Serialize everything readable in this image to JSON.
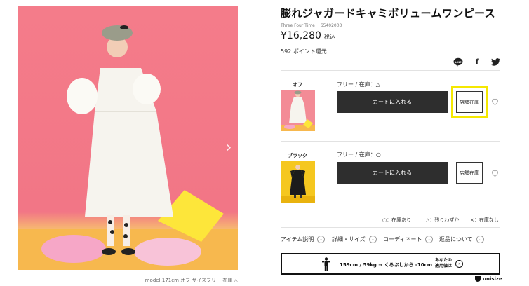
{
  "product": {
    "title": "膨れジャガードキャミボリュームワンピース",
    "brand": "Three Four Time",
    "code": "65402003",
    "price": "¥16,280",
    "tax_label": "税込",
    "points": "592 ポイント還元"
  },
  "photo": {
    "next_arrow": "›",
    "caption": "model:171cm オフ サイズフリー 在庫 △"
  },
  "share": {
    "line_icon": "line-icon",
    "line_label": "LINE",
    "facebook_icon": "facebook-icon",
    "facebook_label": "f",
    "twitter_icon": "twitter-icon"
  },
  "variants": [
    {
      "color": "オフ",
      "stock": "フリー / 在庫：△",
      "cart_label": "カートに入れる",
      "store_label": "店舗在庫",
      "favorite_icon": "heart-icon"
    },
    {
      "color": "ブラック",
      "stock": "フリー / 在庫：○",
      "cart_label": "カートに入れる",
      "store_label": "店舗在庫",
      "favorite_icon": "heart-icon"
    }
  ],
  "legend": {
    "in_stock": "○：在庫あり",
    "few_left": "△：残りわずか",
    "none": "×：在庫なし"
  },
  "tabs": [
    {
      "label": "アイテム説明",
      "icon": "chevron-down-icon",
      "glyph": "⌄"
    },
    {
      "label": "詳細・サイズ",
      "icon": "chevron-down-icon",
      "glyph": "⌄"
    },
    {
      "label": "コーディネート",
      "icon": "chevron-down-icon",
      "glyph": "⌄"
    },
    {
      "label": "返品について",
      "icon": "chevron-down-icon",
      "glyph": "⌄"
    }
  ],
  "unisize": {
    "summary": "159cm / 59kg → くるぶしから -10cm",
    "sub_line1": "あなたの",
    "sub_line2": "適用値は",
    "arrow": "›",
    "logo": "unisize"
  },
  "colors": {
    "cart_button": "#2e2e2e",
    "highlight": "#f5e800",
    "photo_bg": "#f47c8a"
  }
}
